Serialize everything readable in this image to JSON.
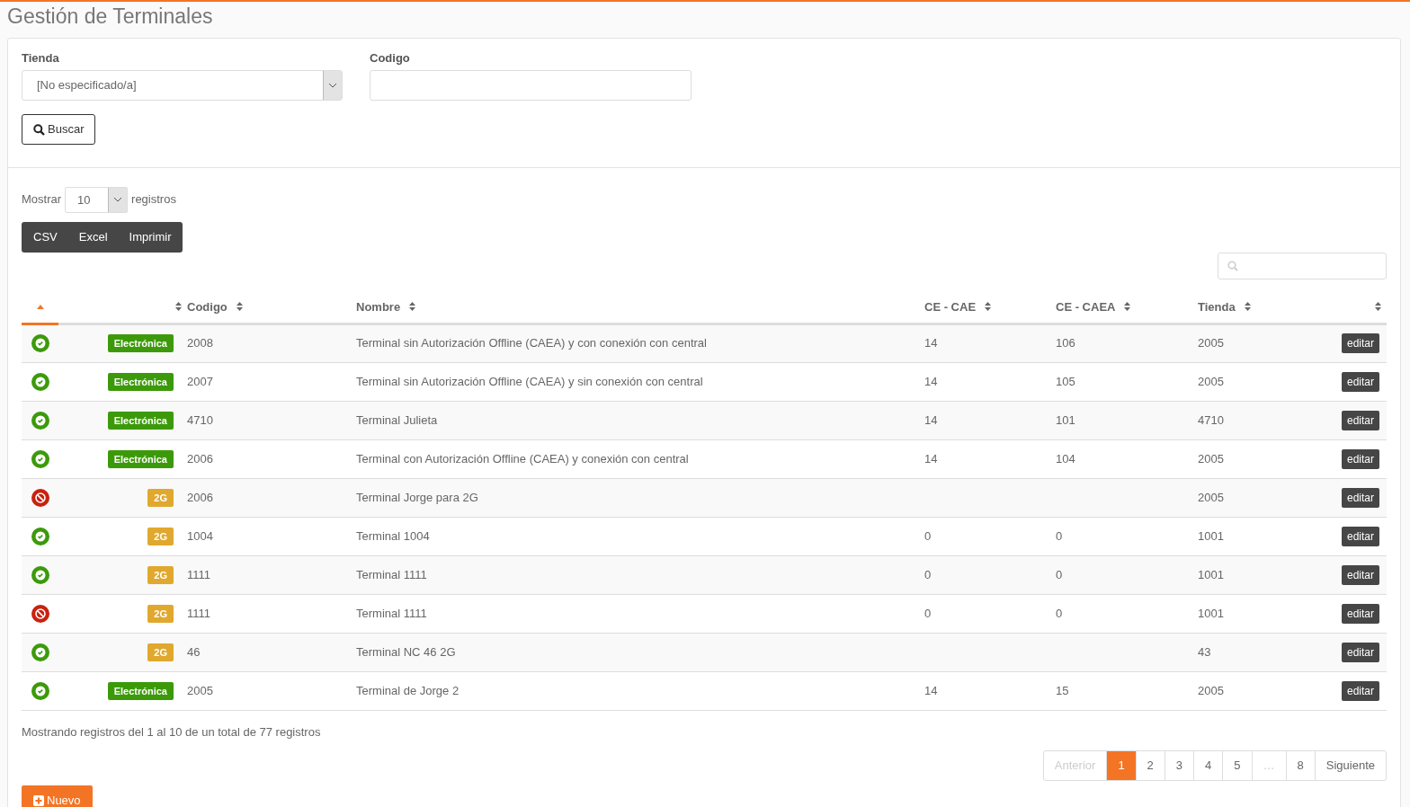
{
  "title": "Gestión de Terminales",
  "filters": {
    "tienda": {
      "label": "Tienda",
      "value": "[No especificado/a]"
    },
    "codigo": {
      "label": "Codigo"
    },
    "search_button": "Buscar"
  },
  "length": {
    "prefix": "Mostrar",
    "value": "10",
    "suffix": "registros"
  },
  "export_buttons": [
    "CSV",
    "Excel",
    "Imprimir"
  ],
  "table": {
    "columns": [
      {
        "sorted": true
      },
      {
        "sorted": false
      },
      {
        "label": "Codigo",
        "sorted": false
      },
      {
        "label": "Nombre",
        "sorted": false
      },
      {
        "label": "CE - CAE",
        "sorted": false
      },
      {
        "label": "CE - CAEA",
        "sorted": false
      },
      {
        "label": "Tienda",
        "sorted": false
      },
      {
        "sorted": false
      }
    ],
    "rows": [
      {
        "active": true,
        "type": {
          "kind": "electronica",
          "label": "Electrónica"
        },
        "codigo": "2008",
        "nombre": "Terminal sin Autorización Offline (CAEA) y con conexión con central",
        "ce_cae": "14",
        "ce_caea": "106",
        "tienda": "2005",
        "action": "editar"
      },
      {
        "active": true,
        "type": {
          "kind": "electronica",
          "label": "Electrónica"
        },
        "codigo": "2007",
        "nombre": "Terminal sin Autorización Offline (CAEA) y sin conexión con central",
        "ce_cae": "14",
        "ce_caea": "105",
        "tienda": "2005",
        "action": "editar"
      },
      {
        "active": true,
        "type": {
          "kind": "electronica",
          "label": "Electrónica"
        },
        "codigo": "4710",
        "nombre": "Terminal Julieta",
        "ce_cae": "14",
        "ce_caea": "101",
        "tienda": "4710",
        "action": "editar"
      },
      {
        "active": true,
        "type": {
          "kind": "electronica",
          "label": "Electrónica"
        },
        "codigo": "2006",
        "nombre": "Terminal con Autorización Offline (CAEA) y conexión con central",
        "ce_cae": "14",
        "ce_caea": "104",
        "tienda": "2005",
        "action": "editar"
      },
      {
        "active": false,
        "type": {
          "kind": "twog",
          "label": "2G"
        },
        "codigo": "2006",
        "nombre": "Terminal Jorge para 2G",
        "tienda": "2005",
        "action": "editar"
      },
      {
        "active": true,
        "type": {
          "kind": "twog",
          "label": "2G"
        },
        "codigo": "1004",
        "nombre": "Terminal 1004",
        "ce_cae": "0",
        "ce_caea": "0",
        "tienda": "1001",
        "action": "editar"
      },
      {
        "active": true,
        "type": {
          "kind": "twog",
          "label": "2G"
        },
        "codigo": "1111",
        "nombre": "Terminal 1111",
        "ce_cae": "0",
        "ce_caea": "0",
        "tienda": "1001",
        "action": "editar"
      },
      {
        "active": false,
        "type": {
          "kind": "twog",
          "label": "2G"
        },
        "codigo": "1111",
        "nombre": "Terminal 1111",
        "ce_cae": "0",
        "ce_caea": "0",
        "tienda": "1001",
        "action": "editar"
      },
      {
        "active": true,
        "type": {
          "kind": "twog",
          "label": "2G"
        },
        "codigo": "46",
        "nombre": "Terminal NC 46 2G",
        "tienda": "43",
        "action": "editar"
      },
      {
        "active": true,
        "type": {
          "kind": "electronica",
          "label": "Electrónica"
        },
        "codigo": "2005",
        "nombre": "Terminal de Jorge 2",
        "ce_cae": "14",
        "ce_caea": "15",
        "tienda": "2005",
        "action": "editar"
      }
    ]
  },
  "info": "Mostrando registros del 1 al 10 de un total de 77 registros",
  "pagination": [
    {
      "label": "Anterior",
      "disabled": true,
      "selected": false
    },
    {
      "label": "1",
      "disabled": false,
      "selected": true
    },
    {
      "label": "2",
      "disabled": false,
      "selected": false
    },
    {
      "label": "3",
      "disabled": false,
      "selected": false
    },
    {
      "label": "4",
      "disabled": false,
      "selected": false
    },
    {
      "label": "5",
      "disabled": false,
      "selected": false
    },
    {
      "label": "…",
      "disabled": true,
      "selected": false
    },
    {
      "label": "8",
      "disabled": false,
      "selected": false
    },
    {
      "label": "Siguiente",
      "disabled": false,
      "selected": false
    }
  ],
  "new_button": "Nuevo"
}
